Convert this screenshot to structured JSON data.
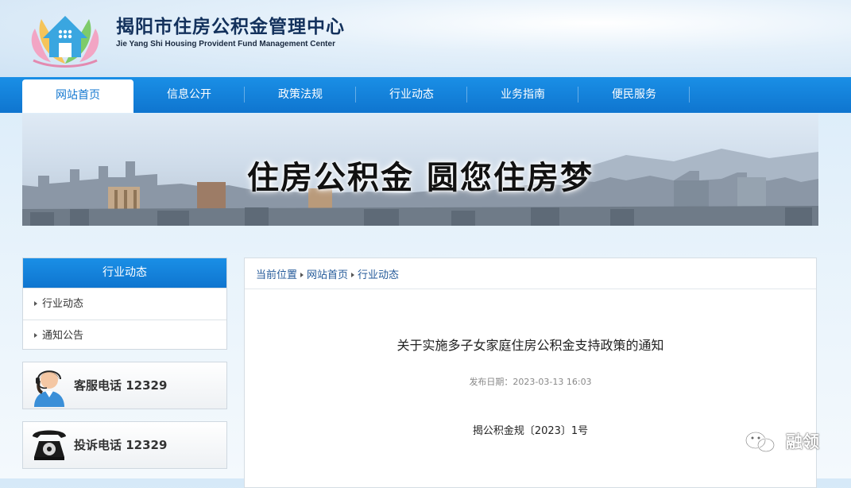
{
  "header": {
    "title": "揭阳市住房公积金管理中心",
    "subtitle": "Jie Yang Shi Housing Provident Fund Management Center",
    "logo": "house-flower-logo"
  },
  "nav": {
    "items": [
      {
        "label": "网站首页",
        "active": true
      },
      {
        "label": "信息公开"
      },
      {
        "label": "政策法规"
      },
      {
        "label": "行业动态"
      },
      {
        "label": "业务指南"
      },
      {
        "label": "便民服务"
      }
    ]
  },
  "banner": {
    "slogan": "住房公积金  圆您住房梦"
  },
  "sidebar": {
    "heading": "行业动态",
    "links": [
      {
        "label": "行业动态"
      },
      {
        "label": "通知公告"
      }
    ],
    "service_phone": "客服电话 12329",
    "complaint_phone": "投诉电话 12329"
  },
  "breadcrumb": {
    "items": [
      {
        "label": "当前位置"
      },
      {
        "label": "网站首页"
      },
      {
        "label": "行业动态"
      }
    ]
  },
  "article": {
    "title": "关于实施多子女家庭住房公积金支持政策的通知",
    "date": "发布日期：2023-03-13 16:03",
    "doc_number": "揭公积金规〔2023〕1号"
  },
  "watermark": {
    "text": "融领",
    "icon": "wechat-icon"
  },
  "colors": {
    "nav_blue": "#1478d0",
    "title_navy": "#13315c",
    "link_blue": "#245a9a"
  }
}
